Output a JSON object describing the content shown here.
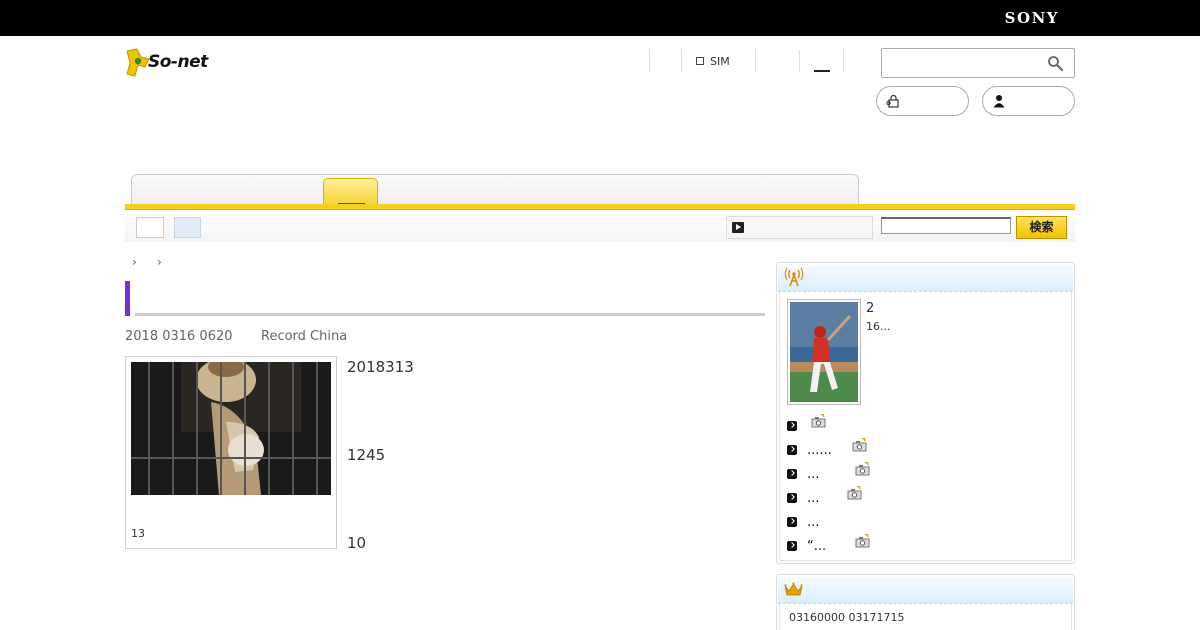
{
  "top_bar": {
    "brand": "SONY"
  },
  "logo": {
    "text": "So-net"
  },
  "header": {
    "sim_label": "SIM"
  },
  "search": {
    "placeholder": ""
  },
  "toolbar": {
    "site_search_button": "検索"
  },
  "article": {
    "meta_date": "2018 0316 0620",
    "meta_source": "Record China",
    "photo_caption": "13",
    "paragraphs": [
      "2018313",
      "1245",
      "10"
    ]
  },
  "sidebar": {
    "featured": {
      "title": "2",
      "subtitle": "16..."
    },
    "news_items": [
      {
        "text": "",
        "has_photo": true
      },
      {
        "text": "......",
        "has_photo": true
      },
      {
        "text": "...",
        "has_photo": true
      },
      {
        "text": "...",
        "has_photo": true
      },
      {
        "text": "...",
        "has_photo": false
      },
      {
        "text": "“...",
        "has_photo": true
      }
    ],
    "ranking": {
      "date_range": "03160000  03171715"
    }
  },
  "colors": {
    "accent_yellow": "#f3cf22",
    "title_purple": "#7b2fd0",
    "sidebar_head": "#d9eefb"
  },
  "icons": [
    "search-icon",
    "lock-icon",
    "user-icon",
    "antenna-icon",
    "crown-icon",
    "camera-icon",
    "play-icon",
    "chevron-right-icon"
  ]
}
